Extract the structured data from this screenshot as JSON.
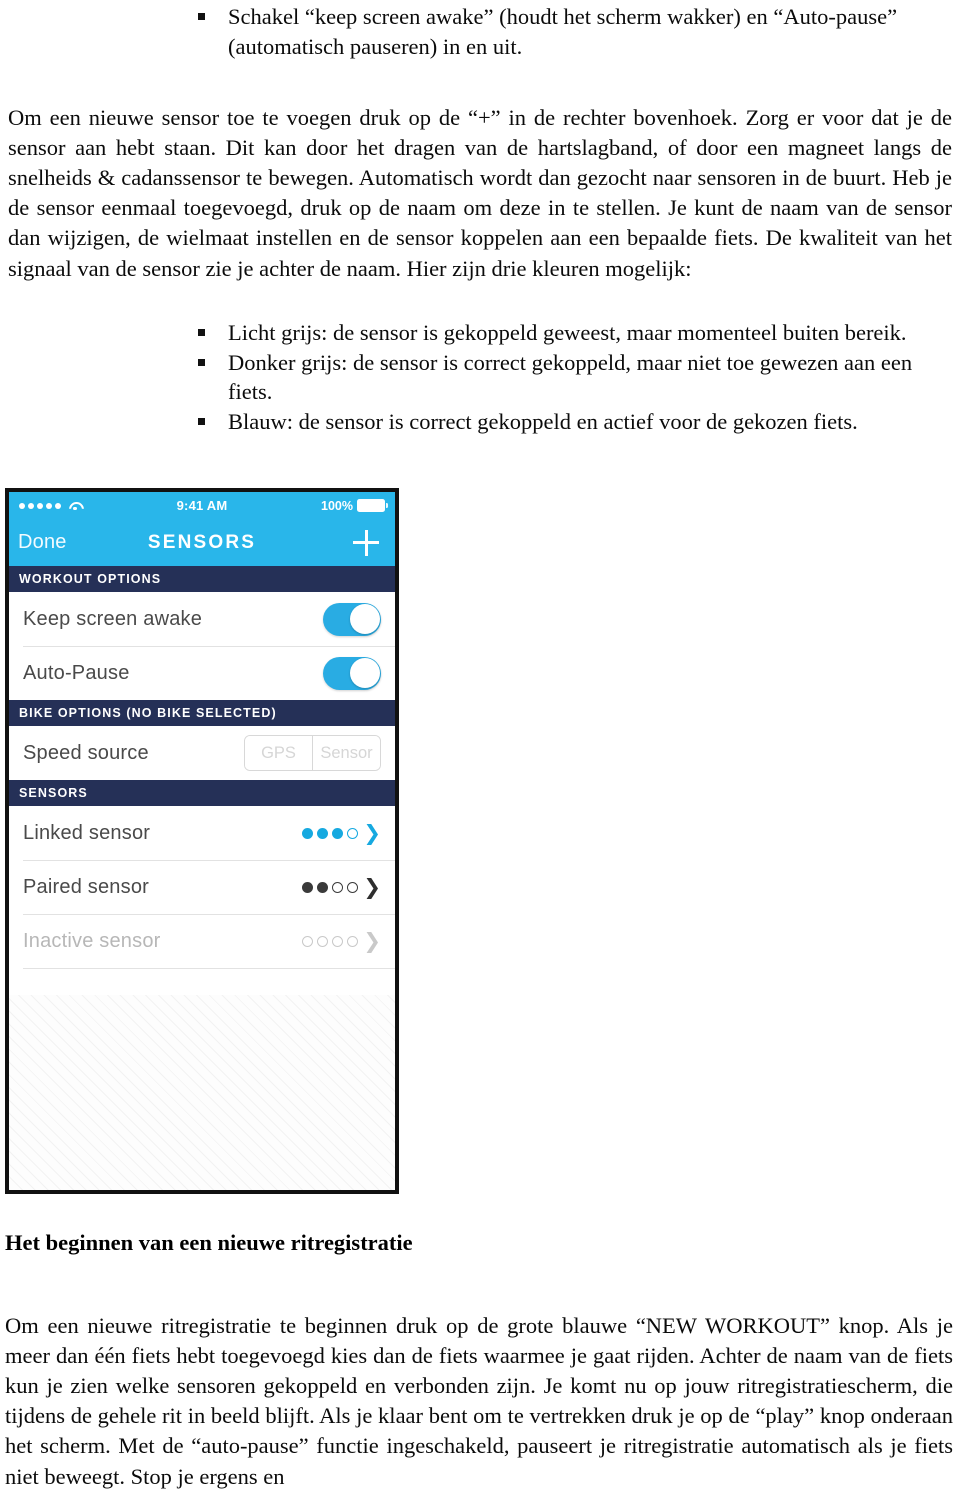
{
  "document": {
    "top_bullets": [
      "Schakel “keep screen awake” (houdt het scherm wakker) en “Auto-pause” (automatisch pauseren) in en uit."
    ],
    "paragraph_add_sensor": "Om een nieuwe sensor toe te voegen druk op de “+” in de rechter bovenhoek. Zorg er voor dat je de sensor aan hebt staan. Dit kan door het dragen van de hartslagband, of door een magneet langs de snelheids & cadanssensor te bewegen. Automatisch wordt dan gezocht naar sensoren in de buurt. Heb je de sensor eenmaal toegevoegd, druk op de naam om deze in te stellen. Je kunt de naam van de sensor dan wijzigen, de wielmaat instellen en de sensor koppelen aan een bepaalde fiets. De kwaliteit van het signaal van de sensor zie je achter de naam. Hier zijn drie kleuren mogelijk:",
    "color_bullets": [
      "Licht grijs: de sensor is gekoppeld geweest, maar momenteel buiten bereik.",
      "Donker grijs: de sensor is correct gekoppeld, maar niet toe gewezen aan een fiets.",
      "Blauw: de sensor is correct gekoppeld en actief voor de gekozen fiets."
    ],
    "heading_new_ride": "Het beginnen van een nieuwe ritregistratie",
    "paragraph_new_ride": "Om een nieuwe ritregistratie te beginnen druk op de grote blauwe “NEW WORKOUT” knop. Als je meer dan één fiets hebt toegevoegd kies dan de fiets waarmee je gaat rijden. Achter de naam van de fiets kun je zien welke sensoren gekoppeld en verbonden zijn. Je komt nu op jouw ritregistratiescherm, die tijdens de gehele rit in beeld blijft. Als je klaar bent om te vertrekken druk je op de “play” knop onderaan het scherm. Met de “auto-pause” functie ingeschakeld, pauseert je ritregistratie automatisch als je fiets niet beweegt. Stop je ergens en"
  },
  "phone": {
    "status_bar": {
      "signal_dots": 5,
      "wifi_icon": "wifi-icon",
      "time": "9:41 AM",
      "battery_percent": "100%",
      "battery_icon": "battery-full-icon"
    },
    "nav": {
      "left_button": "Done",
      "title": "SENSORS",
      "right_icon": "plus-icon"
    },
    "sections": [
      {
        "header": "WORKOUT OPTIONS",
        "rows": [
          {
            "label": "Keep screen awake",
            "control": "toggle",
            "toggle_on": true
          },
          {
            "label": "Auto-Pause",
            "control": "toggle",
            "toggle_on": true
          }
        ]
      },
      {
        "header": "BIKE OPTIONS (NO BIKE SELECTED)",
        "rows": [
          {
            "label": "Speed source",
            "control": "segmented",
            "segments": [
              "GPS",
              "Sensor"
            ],
            "selected": null
          }
        ]
      },
      {
        "header": "SENSORS",
        "rows": [
          {
            "label": "Linked sensor",
            "control": "signal",
            "style": "blue",
            "filled": 3,
            "total": 4,
            "muted": false
          },
          {
            "label": "Paired sensor",
            "control": "signal",
            "style": "dark",
            "filled": 2,
            "total": 4,
            "muted": false
          },
          {
            "label": "Inactive sensor",
            "control": "signal",
            "style": "gray",
            "filled": 0,
            "total": 4,
            "muted": true
          }
        ]
      }
    ],
    "colors": {
      "accent_blue": "#29b6ea",
      "section_navy": "#253057",
      "signal_blue": "#16a9e0",
      "signal_dark": "#3a3a3a",
      "signal_gray": "#c9c9c9"
    }
  }
}
